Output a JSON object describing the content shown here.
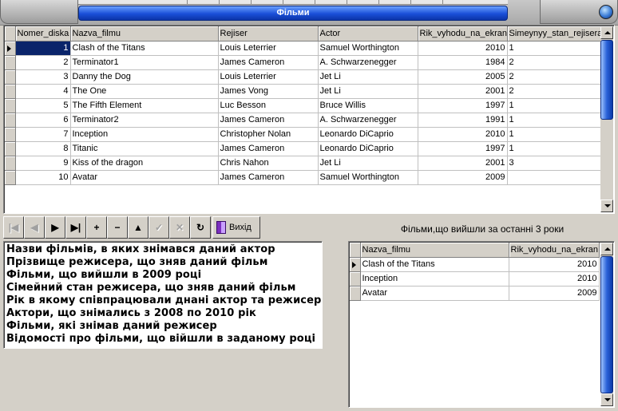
{
  "window": {
    "title": "Фільми"
  },
  "main_grid": {
    "columns": [
      "Nomer_diska",
      "Nazva_filmu",
      "Rejiser",
      "Actor",
      "Rik_vyhodu_na_ekran",
      "Simeynyy_stan_rejisera"
    ],
    "rows": [
      [
        "1",
        "Clash of the Titans",
        "Louis Leterrier",
        "Samuel Worthington",
        "2010",
        "1"
      ],
      [
        "2",
        "Terminator1",
        "James Cameron",
        "A. Schwarzenegger",
        "1984",
        "2"
      ],
      [
        "3",
        "Danny the Dog",
        "Louis Leterrier",
        "Jet Li",
        "2005",
        "2"
      ],
      [
        "4",
        "The One",
        "James Vong",
        "Jet Li",
        "2001",
        "2"
      ],
      [
        "5",
        "The Fifth Element",
        "Luc Besson",
        "Bruce Willis",
        "1997",
        "1"
      ],
      [
        "6",
        "Terminator2",
        "James Cameron",
        "A. Schwarzenegger",
        "1991",
        "1"
      ],
      [
        "7",
        "Inception",
        "Christopher Nolan",
        "Leonardo DiCaprio",
        "2010",
        "1"
      ],
      [
        "8",
        "Titanic",
        "James Cameron",
        "Leonardo DiCaprio",
        "1997",
        "1"
      ],
      [
        "9",
        "Kiss of the dragon",
        "Chris Nahon",
        "Jet Li",
        "2001",
        "3"
      ],
      [
        "10",
        "Avatar",
        "James Cameron",
        "Samuel Worthington",
        "2009",
        ""
      ]
    ]
  },
  "navigator": {
    "buttons": [
      {
        "name": "first-record-button",
        "glyph": "|◀",
        "enabled": false
      },
      {
        "name": "prior-record-button",
        "glyph": "◀",
        "enabled": false
      },
      {
        "name": "next-record-button",
        "glyph": "▶",
        "enabled": true
      },
      {
        "name": "last-record-button",
        "glyph": "▶|",
        "enabled": true
      },
      {
        "name": "insert-record-button",
        "glyph": "+",
        "enabled": true
      },
      {
        "name": "delete-record-button",
        "glyph": "−",
        "enabled": true
      },
      {
        "name": "edit-record-button",
        "glyph": "▲",
        "enabled": true
      },
      {
        "name": "post-record-button",
        "glyph": "✓",
        "enabled": false
      },
      {
        "name": "cancel-record-button",
        "glyph": "✕",
        "enabled": false
      },
      {
        "name": "refresh-button",
        "glyph": "↻",
        "enabled": true
      }
    ],
    "exit_label": "Вихід"
  },
  "queries": [
    "Назви фільмів, в яких знімався даний актор",
    "Прізвище режисера, що зняв даний фільм",
    "Фільми, що вийшли в 2009 році",
    "Сімейний стан режисера, що зняв даний фільм",
    "Рік в якому співпрацювали днані актор та режисер",
    "Актори, що знімались з 2008 по 2010 рік",
    "Фільми, які знімав даний режисер",
    "Відомості про фільми, що війшли в заданому році"
  ],
  "recent": {
    "caption": "Фільми,що вийшли за останні 3 роки",
    "columns": [
      "Nazva_filmu",
      "Rik_vyhodu_na_ekran"
    ],
    "rows": [
      [
        "Clash of the Titans",
        "2010"
      ],
      [
        "Inception",
        "2010"
      ],
      [
        "Avatar",
        "2009"
      ]
    ]
  }
}
